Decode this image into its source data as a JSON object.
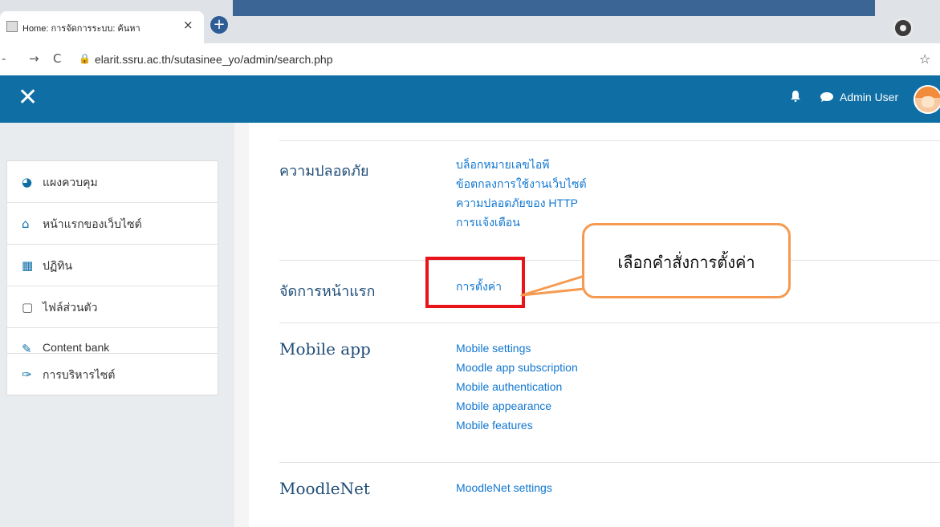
{
  "browser": {
    "tab_title": "Home: การจัดการระบบ: ค้นหา",
    "tab_close": "×",
    "new_tab": "+",
    "url": "elarit.ssru.ac.th/sutasinee_yo/admin/search.php"
  },
  "header": {
    "close_glyph": "✕",
    "user_name": "Admin User",
    "accent": "#0f6fa5"
  },
  "sidebar": {
    "items": [
      {
        "label": "แผงควบคุม",
        "icon": "dashboard-icon",
        "glyph": "◕"
      },
      {
        "label": "หน้าแรกของเว็บไซต์",
        "icon": "home-icon",
        "glyph": "⌂"
      },
      {
        "label": "ปฏิทิน",
        "icon": "calendar-icon",
        "glyph": "▦"
      },
      {
        "label": "ไฟล์ส่วนตัว",
        "icon": "file-icon",
        "glyph": "▢"
      },
      {
        "label": "Content bank",
        "icon": "paintbrush-icon",
        "glyph": "✎"
      }
    ],
    "admin_item": {
      "label": "การบริหารไซต์",
      "icon": "wrench-icon",
      "glyph": "✑"
    }
  },
  "sections": [
    {
      "title": "ความปลอดภัย",
      "links": [
        "บล็อกหมายเลขไอพี",
        "ข้อตกลงการใช้งานเว็บไซต์",
        "ความปลอดภัยของ HTTP",
        "การแจ้งเตือน"
      ]
    },
    {
      "title": "จัดการหน้าแรก",
      "links": [
        "การตั้งค่า"
      ]
    },
    {
      "title": "Mobile app",
      "links": [
        "Mobile settings",
        "Moodle app subscription",
        "Mobile authentication",
        "Mobile appearance",
        "Mobile features"
      ]
    },
    {
      "title": "MoodleNet",
      "links": [
        "MoodleNet settings"
      ]
    }
  ],
  "annotation": {
    "callout_text": "เลือกคำสั่งการตั้งค่า",
    "highlight_color": "#e8141a",
    "callout_color": "#f59a50"
  }
}
